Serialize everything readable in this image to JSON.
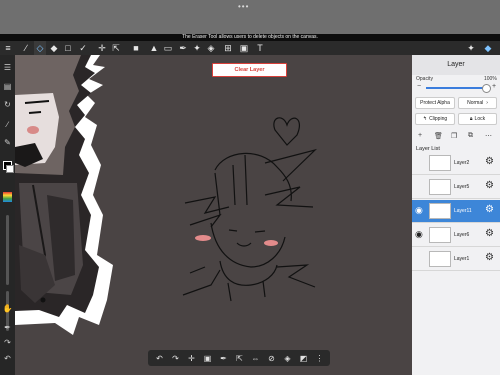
{
  "app": {
    "hint": "The Eraser Tool allows users to delete objects on the canvas.",
    "top_dots": "•••"
  },
  "toolbar": {
    "menu_icon": "≡",
    "tools": [
      {
        "name": "brush-icon",
        "glyph": "∕"
      },
      {
        "name": "eraser-icon",
        "glyph": "◇",
        "active": true
      },
      {
        "name": "smudge-icon",
        "glyph": "◆"
      },
      {
        "name": "rect-select-icon",
        "glyph": "□"
      },
      {
        "name": "lasso-check-icon",
        "glyph": "✓"
      },
      {
        "name": "move-icon",
        "glyph": "✛"
      },
      {
        "name": "transform-icon",
        "glyph": "⇱"
      },
      {
        "name": "fill-color-icon",
        "glyph": "■"
      },
      {
        "name": "bucket-icon",
        "glyph": "▲"
      },
      {
        "name": "gradient-icon",
        "glyph": "▭"
      },
      {
        "name": "eyedropper-icon",
        "glyph": "✒"
      },
      {
        "name": "magic-wand-icon",
        "glyph": "✦"
      },
      {
        "name": "selection-eraser-icon",
        "glyph": "◈"
      },
      {
        "name": "frame-icon",
        "glyph": "⊞"
      },
      {
        "name": "image-icon",
        "glyph": "▣"
      },
      {
        "name": "text-icon",
        "glyph": "T"
      }
    ],
    "materials_icon": "✦",
    "layers_icon": "◆"
  },
  "left_bar": {
    "items": [
      {
        "name": "layers-toggle-icon",
        "glyph": "☰"
      },
      {
        "name": "navigator-icon",
        "glyph": "▤"
      },
      {
        "name": "rotate-icon",
        "glyph": "↻"
      },
      {
        "name": "ruler-icon",
        "glyph": "∕"
      },
      {
        "name": "pen-icon",
        "glyph": "✎"
      }
    ],
    "bottom_items": [
      {
        "name": "hand-icon",
        "glyph": "✋"
      },
      {
        "name": "pen-pressure-icon",
        "glyph": "✒"
      },
      {
        "name": "redo-icon",
        "glyph": "↷"
      },
      {
        "name": "undo-icon",
        "glyph": "↶"
      }
    ]
  },
  "canvas": {
    "clear_layer_label": "Clear Layer"
  },
  "bottom_bar": {
    "items": [
      {
        "name": "undo-icon",
        "glyph": "↶"
      },
      {
        "name": "redo-icon",
        "glyph": "↷"
      },
      {
        "name": "select-move-icon",
        "glyph": "✛"
      },
      {
        "name": "swap-colors-icon",
        "glyph": "▣"
      },
      {
        "name": "eyedropper-icon",
        "glyph": "✒"
      },
      {
        "name": "transform-icon",
        "glyph": "⇱"
      },
      {
        "name": "flip-icon",
        "glyph": "⇔"
      },
      {
        "name": "deselect-icon",
        "glyph": "⊘"
      },
      {
        "name": "save-icon",
        "glyph": "◈"
      },
      {
        "name": "share-icon",
        "glyph": "◩"
      },
      {
        "name": "more-icon",
        "glyph": "⋮"
      }
    ]
  },
  "panel": {
    "title": "Layer",
    "opacity_label": "Opacity",
    "opacity_value": "100%",
    "opacity_fraction": 1.0,
    "protect_alpha": "Protect Alpha",
    "blend_mode": "Normal",
    "clipping": "Clipping",
    "lock": "Lock",
    "layer_list_label": "Layer List",
    "layers": [
      {
        "name": "Layer2",
        "visible": false,
        "selected": false
      },
      {
        "name": "Layer5",
        "visible": false,
        "selected": false
      },
      {
        "name": "Layer11",
        "visible": true,
        "selected": true
      },
      {
        "name": "Layer6",
        "visible": true,
        "selected": false
      },
      {
        "name": "Layer1",
        "visible": false,
        "selected": false
      }
    ]
  },
  "colors": {
    "accent": "#3d86d8",
    "canvas": "#4a4444",
    "warning": "#d8403a"
  }
}
